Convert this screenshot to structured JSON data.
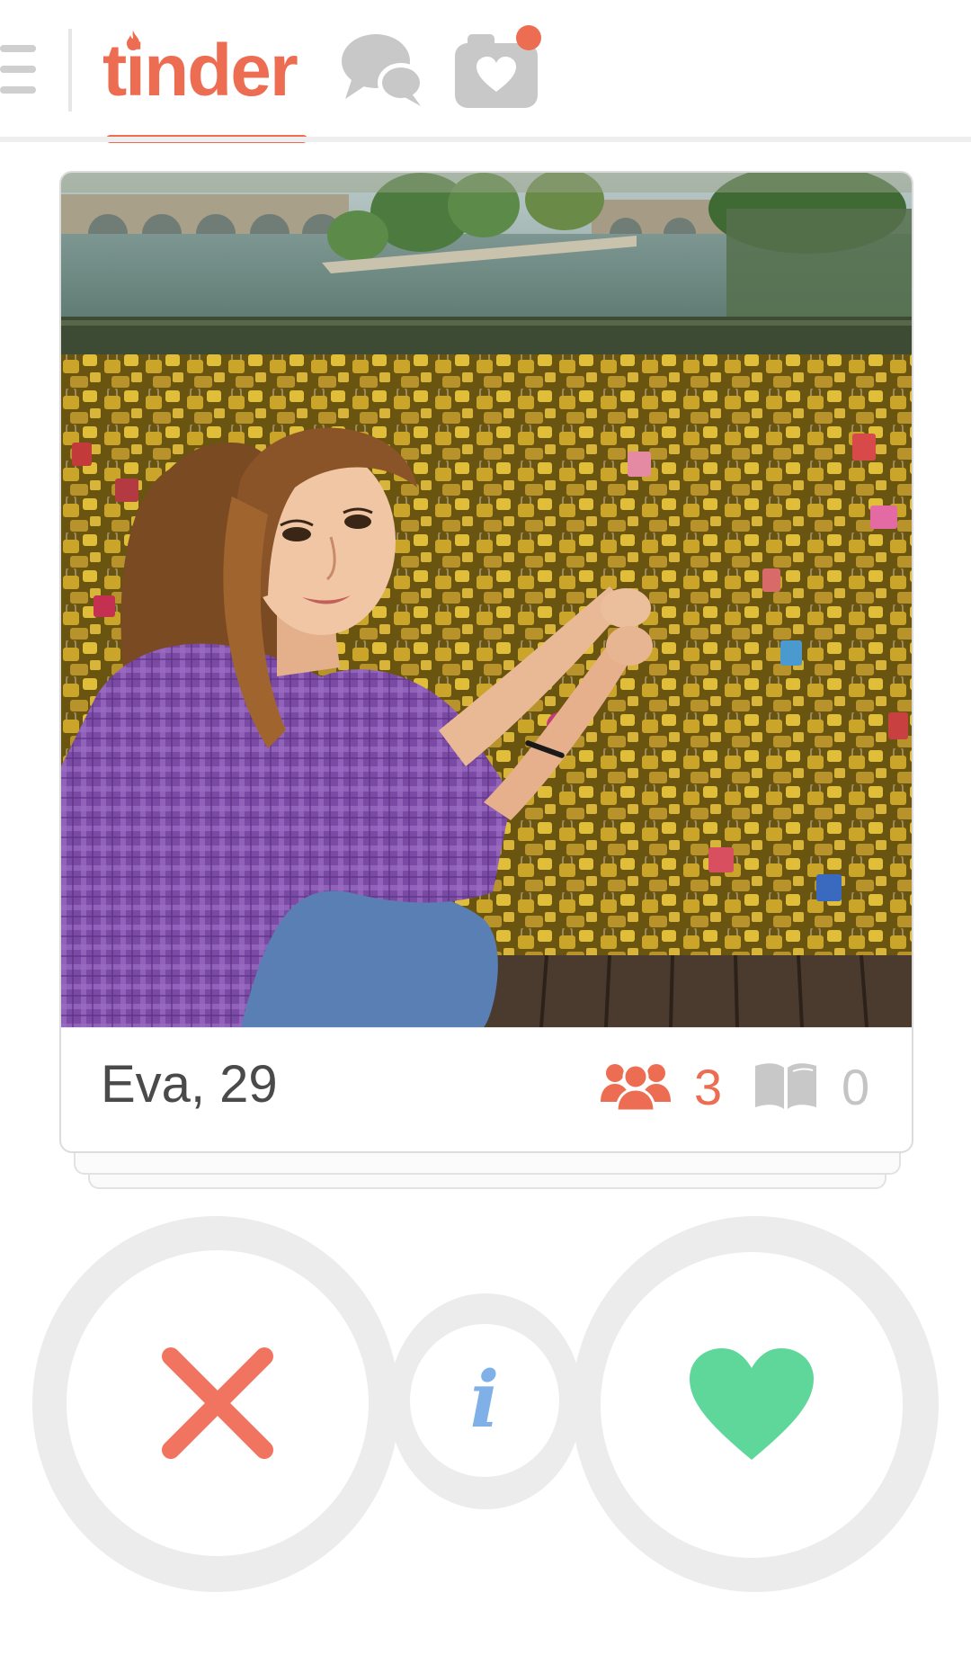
{
  "header": {
    "logo_text": "tinder",
    "brand_color": "#ec6d52",
    "icons": [
      "menu-icon",
      "chat-icon",
      "moments-icon"
    ],
    "notification_dot": true
  },
  "profile": {
    "name_age": "Eva, 29",
    "mutual_friends_count": "3",
    "shared_interests_count": "0",
    "photo_description": "Woman in purple plaid shirt crouching beside love-lock bridge over a river",
    "stack_depth": 3
  },
  "actions": {
    "nope_color": "#f07460",
    "info_color": "#7fb1e8",
    "like_color": "#5fd79a"
  }
}
